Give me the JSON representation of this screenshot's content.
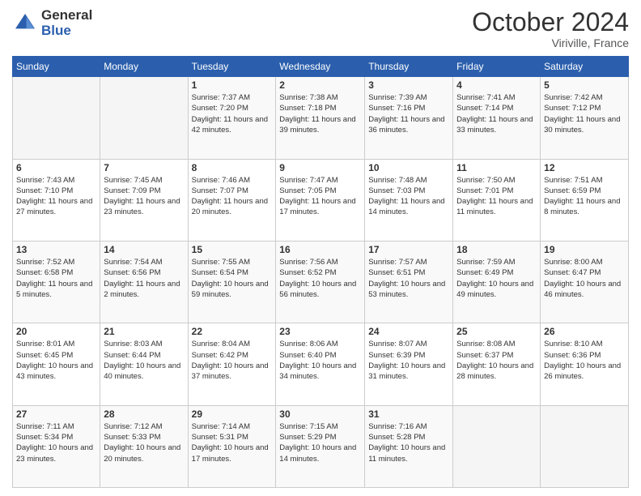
{
  "header": {
    "logo_line1": "General",
    "logo_line2": "Blue",
    "month": "October 2024",
    "location": "Viriville, France"
  },
  "weekdays": [
    "Sunday",
    "Monday",
    "Tuesday",
    "Wednesday",
    "Thursday",
    "Friday",
    "Saturday"
  ],
  "weeks": [
    [
      {
        "day": "",
        "sunrise": "",
        "sunset": "",
        "daylight": ""
      },
      {
        "day": "",
        "sunrise": "",
        "sunset": "",
        "daylight": ""
      },
      {
        "day": "1",
        "sunrise": "Sunrise: 7:37 AM",
        "sunset": "Sunset: 7:20 PM",
        "daylight": "Daylight: 11 hours and 42 minutes."
      },
      {
        "day": "2",
        "sunrise": "Sunrise: 7:38 AM",
        "sunset": "Sunset: 7:18 PM",
        "daylight": "Daylight: 11 hours and 39 minutes."
      },
      {
        "day": "3",
        "sunrise": "Sunrise: 7:39 AM",
        "sunset": "Sunset: 7:16 PM",
        "daylight": "Daylight: 11 hours and 36 minutes."
      },
      {
        "day": "4",
        "sunrise": "Sunrise: 7:41 AM",
        "sunset": "Sunset: 7:14 PM",
        "daylight": "Daylight: 11 hours and 33 minutes."
      },
      {
        "day": "5",
        "sunrise": "Sunrise: 7:42 AM",
        "sunset": "Sunset: 7:12 PM",
        "daylight": "Daylight: 11 hours and 30 minutes."
      }
    ],
    [
      {
        "day": "6",
        "sunrise": "Sunrise: 7:43 AM",
        "sunset": "Sunset: 7:10 PM",
        "daylight": "Daylight: 11 hours and 27 minutes."
      },
      {
        "day": "7",
        "sunrise": "Sunrise: 7:45 AM",
        "sunset": "Sunset: 7:09 PM",
        "daylight": "Daylight: 11 hours and 23 minutes."
      },
      {
        "day": "8",
        "sunrise": "Sunrise: 7:46 AM",
        "sunset": "Sunset: 7:07 PM",
        "daylight": "Daylight: 11 hours and 20 minutes."
      },
      {
        "day": "9",
        "sunrise": "Sunrise: 7:47 AM",
        "sunset": "Sunset: 7:05 PM",
        "daylight": "Daylight: 11 hours and 17 minutes."
      },
      {
        "day": "10",
        "sunrise": "Sunrise: 7:48 AM",
        "sunset": "Sunset: 7:03 PM",
        "daylight": "Daylight: 11 hours and 14 minutes."
      },
      {
        "day": "11",
        "sunrise": "Sunrise: 7:50 AM",
        "sunset": "Sunset: 7:01 PM",
        "daylight": "Daylight: 11 hours and 11 minutes."
      },
      {
        "day": "12",
        "sunrise": "Sunrise: 7:51 AM",
        "sunset": "Sunset: 6:59 PM",
        "daylight": "Daylight: 11 hours and 8 minutes."
      }
    ],
    [
      {
        "day": "13",
        "sunrise": "Sunrise: 7:52 AM",
        "sunset": "Sunset: 6:58 PM",
        "daylight": "Daylight: 11 hours and 5 minutes."
      },
      {
        "day": "14",
        "sunrise": "Sunrise: 7:54 AM",
        "sunset": "Sunset: 6:56 PM",
        "daylight": "Daylight: 11 hours and 2 minutes."
      },
      {
        "day": "15",
        "sunrise": "Sunrise: 7:55 AM",
        "sunset": "Sunset: 6:54 PM",
        "daylight": "Daylight: 10 hours and 59 minutes."
      },
      {
        "day": "16",
        "sunrise": "Sunrise: 7:56 AM",
        "sunset": "Sunset: 6:52 PM",
        "daylight": "Daylight: 10 hours and 56 minutes."
      },
      {
        "day": "17",
        "sunrise": "Sunrise: 7:57 AM",
        "sunset": "Sunset: 6:51 PM",
        "daylight": "Daylight: 10 hours and 53 minutes."
      },
      {
        "day": "18",
        "sunrise": "Sunrise: 7:59 AM",
        "sunset": "Sunset: 6:49 PM",
        "daylight": "Daylight: 10 hours and 49 minutes."
      },
      {
        "day": "19",
        "sunrise": "Sunrise: 8:00 AM",
        "sunset": "Sunset: 6:47 PM",
        "daylight": "Daylight: 10 hours and 46 minutes."
      }
    ],
    [
      {
        "day": "20",
        "sunrise": "Sunrise: 8:01 AM",
        "sunset": "Sunset: 6:45 PM",
        "daylight": "Daylight: 10 hours and 43 minutes."
      },
      {
        "day": "21",
        "sunrise": "Sunrise: 8:03 AM",
        "sunset": "Sunset: 6:44 PM",
        "daylight": "Daylight: 10 hours and 40 minutes."
      },
      {
        "day": "22",
        "sunrise": "Sunrise: 8:04 AM",
        "sunset": "Sunset: 6:42 PM",
        "daylight": "Daylight: 10 hours and 37 minutes."
      },
      {
        "day": "23",
        "sunrise": "Sunrise: 8:06 AM",
        "sunset": "Sunset: 6:40 PM",
        "daylight": "Daylight: 10 hours and 34 minutes."
      },
      {
        "day": "24",
        "sunrise": "Sunrise: 8:07 AM",
        "sunset": "Sunset: 6:39 PM",
        "daylight": "Daylight: 10 hours and 31 minutes."
      },
      {
        "day": "25",
        "sunrise": "Sunrise: 8:08 AM",
        "sunset": "Sunset: 6:37 PM",
        "daylight": "Daylight: 10 hours and 28 minutes."
      },
      {
        "day": "26",
        "sunrise": "Sunrise: 8:10 AM",
        "sunset": "Sunset: 6:36 PM",
        "daylight": "Daylight: 10 hours and 26 minutes."
      }
    ],
    [
      {
        "day": "27",
        "sunrise": "Sunrise: 7:11 AM",
        "sunset": "Sunset: 5:34 PM",
        "daylight": "Daylight: 10 hours and 23 minutes."
      },
      {
        "day": "28",
        "sunrise": "Sunrise: 7:12 AM",
        "sunset": "Sunset: 5:33 PM",
        "daylight": "Daylight: 10 hours and 20 minutes."
      },
      {
        "day": "29",
        "sunrise": "Sunrise: 7:14 AM",
        "sunset": "Sunset: 5:31 PM",
        "daylight": "Daylight: 10 hours and 17 minutes."
      },
      {
        "day": "30",
        "sunrise": "Sunrise: 7:15 AM",
        "sunset": "Sunset: 5:29 PM",
        "daylight": "Daylight: 10 hours and 14 minutes."
      },
      {
        "day": "31",
        "sunrise": "Sunrise: 7:16 AM",
        "sunset": "Sunset: 5:28 PM",
        "daylight": "Daylight: 10 hours and 11 minutes."
      },
      {
        "day": "",
        "sunrise": "",
        "sunset": "",
        "daylight": ""
      },
      {
        "day": "",
        "sunrise": "",
        "sunset": "",
        "daylight": ""
      }
    ]
  ]
}
